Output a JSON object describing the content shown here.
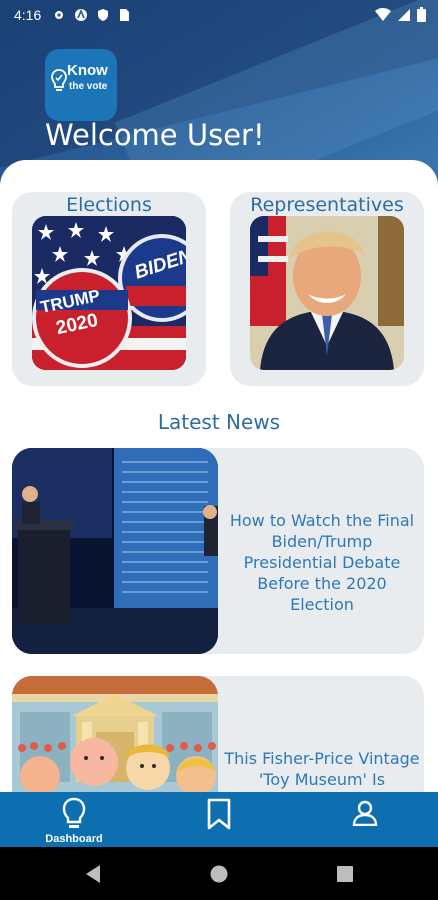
{
  "status_bar": {
    "time": "4:16"
  },
  "logo": {
    "line1": "Know",
    "line2": "the vote"
  },
  "welcome": "Welcome User!",
  "cards": {
    "elections": {
      "label": "Elections",
      "badge_top": "TRUMP",
      "badge_year": "2020",
      "badge2": "BIDEN"
    },
    "representatives": {
      "label": "Representatives"
    }
  },
  "latest_news": {
    "title": "Latest News",
    "items": [
      {
        "headline": "How to Watch the Final Biden/Trump Presidential Debate Before the 2020 Election"
      },
      {
        "headline": "This Fisher-Price Vintage 'Toy Museum' Is"
      }
    ]
  },
  "bottom_nav": {
    "items": [
      {
        "label": "Dashboard",
        "icon": "lightbulb-icon",
        "active": true
      },
      {
        "label": "",
        "icon": "bookmark-icon"
      },
      {
        "label": "",
        "icon": "person-icon"
      }
    ]
  },
  "colors": {
    "primary": "#0d6fb0",
    "accent_text": "#2e6da4",
    "card_bg": "#e9ecef"
  }
}
